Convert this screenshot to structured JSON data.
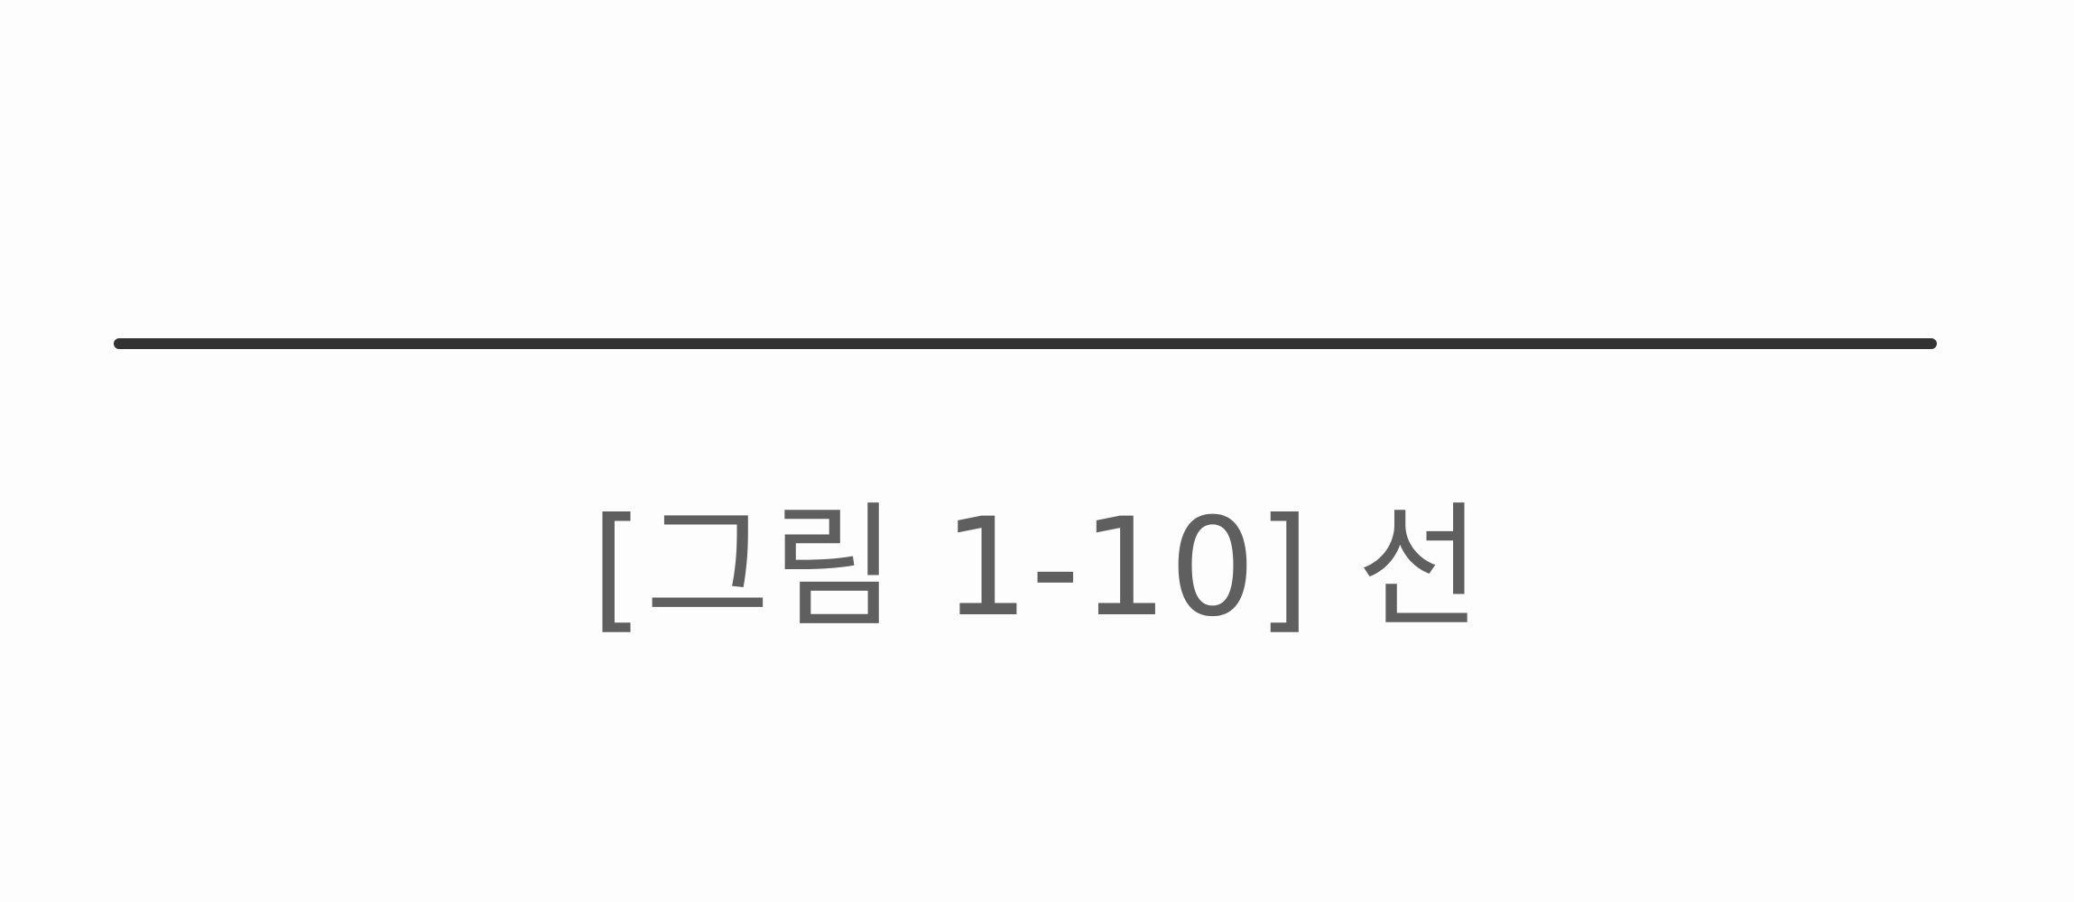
{
  "figure": {
    "caption": "[그림 1-10] 선",
    "line_color": "#333333",
    "caption_color": "#5f5f5f"
  }
}
